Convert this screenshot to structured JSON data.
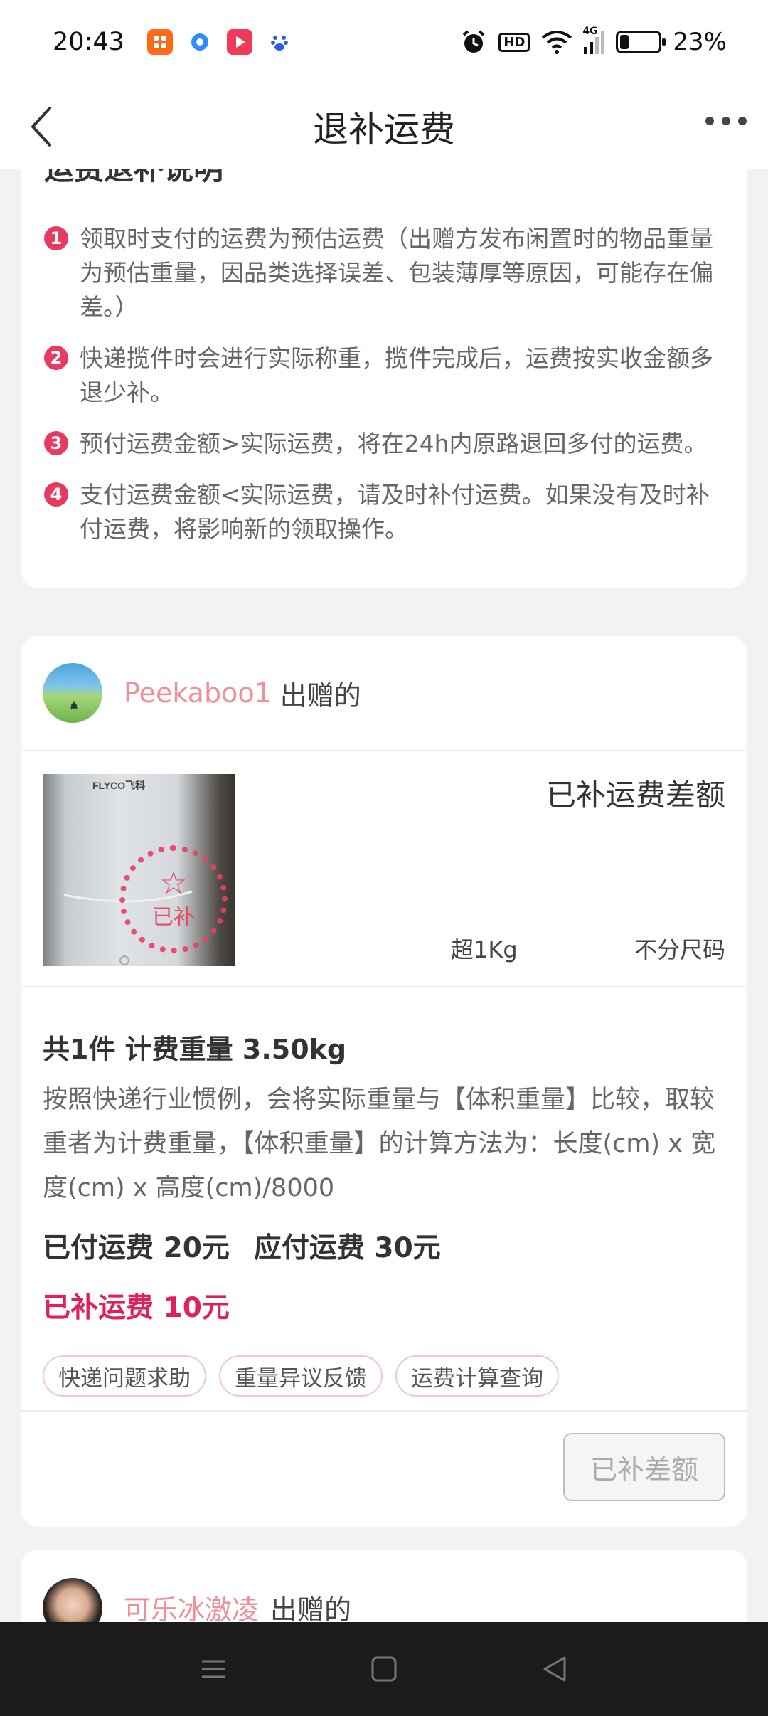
{
  "status_bar": {
    "time": "20:43",
    "hd_label": "HD",
    "network": "4G",
    "battery_percent": "23%",
    "battery_level": 0.23
  },
  "nav": {
    "title": "退补运费"
  },
  "explain": {
    "title": "运费退补说明",
    "items": [
      {
        "num": "1",
        "text": "领取时支付的运费为预估运费（出赠方发布闲置时的物品重量为预估重量，因品类选择误差、包装薄厚等原因，可能存在偏差。）"
      },
      {
        "num": "2",
        "text": "快递揽件时会进行实际称重，揽件完成后，运费按实收金额多退少补。"
      },
      {
        "num": "3",
        "text": "预付运费金额>实际运费，将在24h内原路退回多付的运费。"
      },
      {
        "num": "4",
        "text": "支付运费金额<实际运费，请及时补付运费。如果没有及时补付运费，将影响新的领取操作。"
      }
    ]
  },
  "order": {
    "user_name": "Peekaboo1",
    "user_suffix": "出赠的",
    "product_brand": "FLYCO飞科",
    "stamp_text": "已补",
    "status": "已补运费差额",
    "spec_weight": "超1Kg",
    "spec_size": "不分尺码",
    "weight_line": "共1件 计费重量 3.50kg",
    "rule_text": "按照快递行业惯例，会将实际重量与【体积重量】比较，取较重者为计费重量，【体积重量】的计算方法为：长度(cm) x 宽度(cm) x 高度(cm)/8000",
    "paid_fee": "已付运费 20元",
    "due_fee": "应付运费 30元",
    "supplemented_fee": "已补运费 10元",
    "tags": [
      "快递问题求助",
      "重量异议反馈",
      "运费计算查询"
    ],
    "action_button": "已补差额"
  },
  "next_order": {
    "user_name": "可乐冰激凌",
    "user_suffix": "出赠的"
  },
  "colors": {
    "accent": "#e0205a",
    "user_name": "#ef8f9a",
    "badge": "#e63a60"
  }
}
